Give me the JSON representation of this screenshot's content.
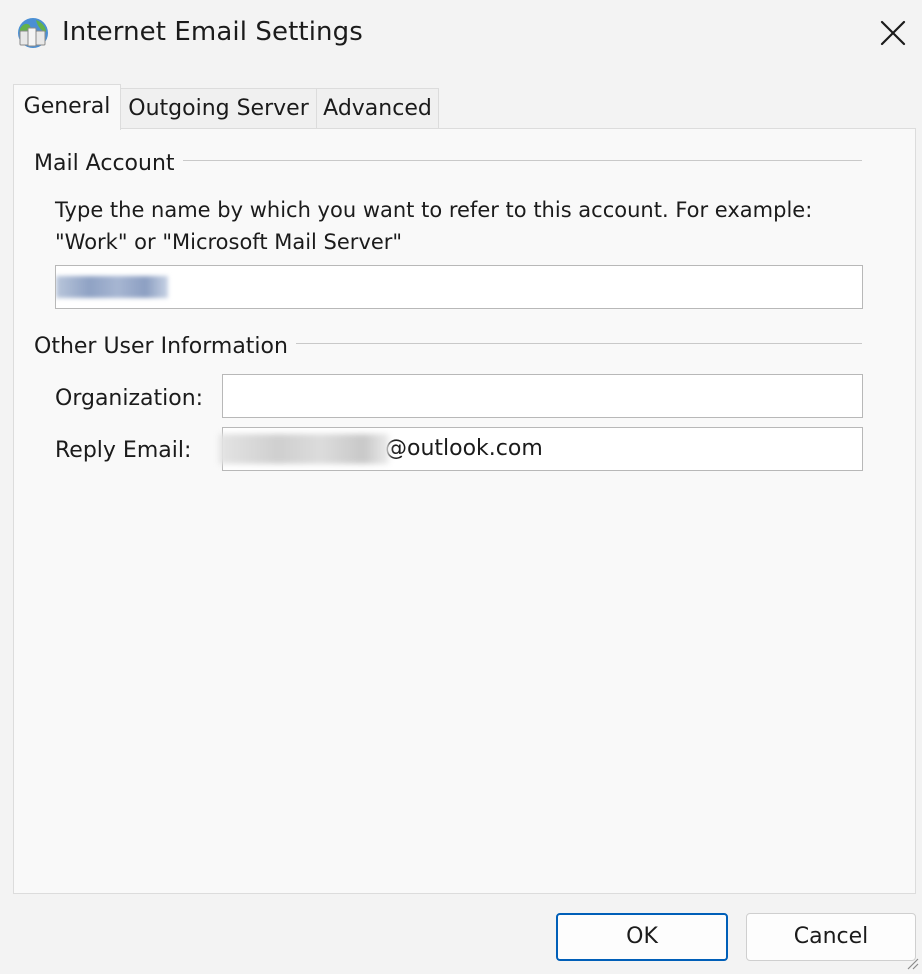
{
  "window": {
    "title": "Internet Email Settings",
    "app_icon": "outlook-globe-icon",
    "close_icon": "close-icon"
  },
  "tabs": [
    {
      "label": "General",
      "selected": true
    },
    {
      "label": "Outgoing Server",
      "selected": false
    },
    {
      "label": "Advanced",
      "selected": false
    }
  ],
  "mail_account": {
    "group_title": "Mail Account",
    "description_line1": "Type the name by which you want to refer to this account. For example:",
    "description_line2": "\"Work\" or \"Microsoft Mail Server\"",
    "account_name_value": ""
  },
  "other_user_info": {
    "group_title": "Other User Information",
    "organization_label": "Organization:",
    "organization_value": "",
    "reply_email_label": "Reply Email:",
    "reply_email_suffix": "@outlook.com"
  },
  "buttons": {
    "ok": "OK",
    "cancel": "Cancel"
  },
  "colors": {
    "accent": "#005fb8",
    "window_bg": "#f3f3f3",
    "panel_bg": "#f9f9f9"
  }
}
